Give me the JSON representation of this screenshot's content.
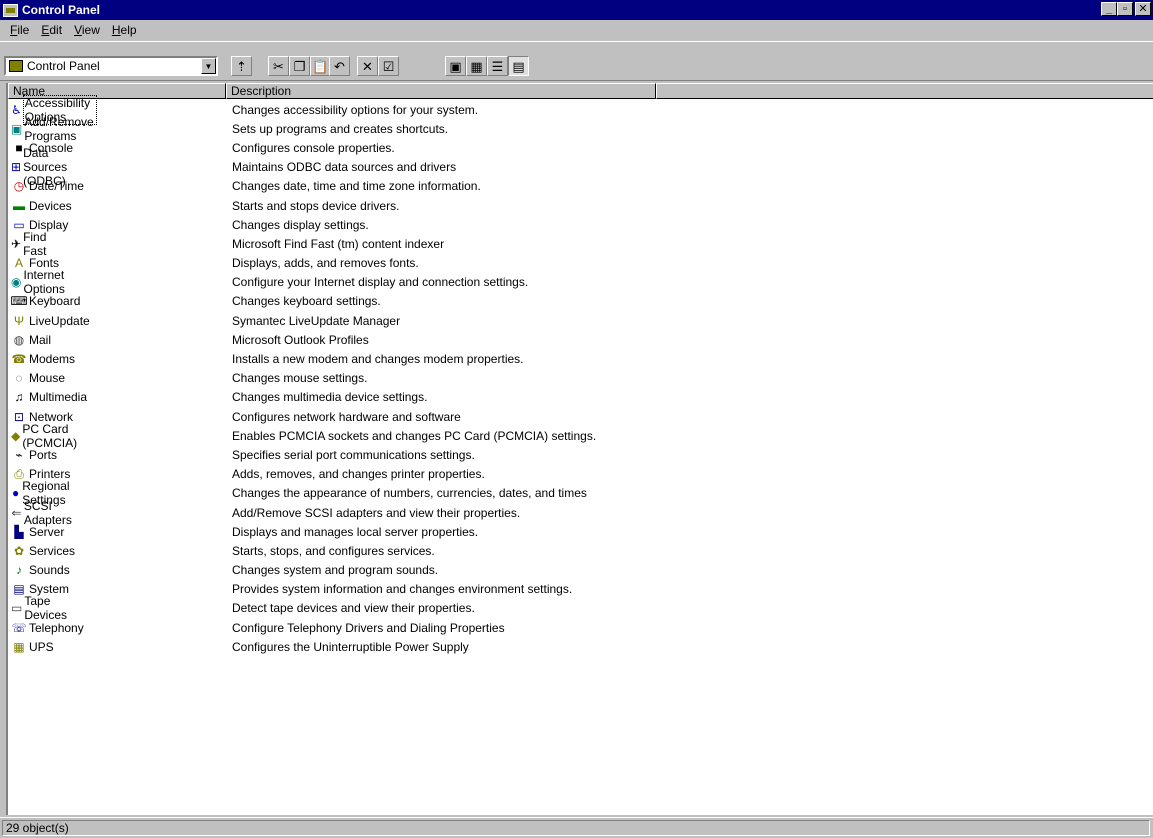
{
  "window": {
    "title": "Control Panel",
    "buttons": [
      "_",
      "▫",
      "✕"
    ]
  },
  "menu": [
    {
      "label": "File"
    },
    {
      "label": "Edit"
    },
    {
      "label": "View"
    },
    {
      "label": "Help"
    }
  ],
  "address": {
    "value": "Control Panel"
  },
  "toolbar": {
    "buttons": [
      {
        "icon": "up-folder-icon",
        "glyph": "⇡"
      },
      {
        "icon": "cut-icon",
        "glyph": "✂"
      },
      {
        "icon": "copy-icon",
        "glyph": "❐"
      },
      {
        "icon": "paste-icon",
        "glyph": "📋"
      },
      {
        "icon": "undo-icon",
        "glyph": "↶"
      },
      {
        "icon": "delete-icon",
        "glyph": "✕"
      },
      {
        "icon": "properties-icon",
        "glyph": "☑"
      },
      {
        "icon": "large-icons-view-icon",
        "glyph": "▣"
      },
      {
        "icon": "small-icons-view-icon",
        "glyph": "▦"
      },
      {
        "icon": "list-view-icon",
        "glyph": "☰"
      },
      {
        "icon": "details-view-icon",
        "glyph": "▤"
      }
    ]
  },
  "columns": {
    "name": "Name",
    "description": "Description"
  },
  "items": [
    {
      "name": "Accessibility Options",
      "description": "Changes accessibility options for your system.",
      "icon": "accessibility-icon",
      "glyph": "♿",
      "color": "#0000c0"
    },
    {
      "name": "Add/Remove Programs",
      "description": "Sets up programs and creates shortcuts.",
      "icon": "add-remove-programs-icon",
      "glyph": "▣",
      "color": "#008080"
    },
    {
      "name": "Console",
      "description": "Configures console properties.",
      "icon": "console-icon",
      "glyph": "■",
      "color": "#000000"
    },
    {
      "name": "Data Sources (ODBC)",
      "description": "Maintains ODBC data sources and drivers",
      "icon": "odbc-icon",
      "glyph": "⊞",
      "color": "#0000a0"
    },
    {
      "name": "Date/Time",
      "description": "Changes date, time and time zone information.",
      "icon": "date-time-icon",
      "glyph": "◷",
      "color": "#c00000"
    },
    {
      "name": "Devices",
      "description": "Starts and stops device drivers.",
      "icon": "devices-icon",
      "glyph": "▬",
      "color": "#008000"
    },
    {
      "name": "Display",
      "description": "Changes display settings.",
      "icon": "display-icon",
      "glyph": "▭",
      "color": "#0000c0"
    },
    {
      "name": "Find Fast",
      "description": "Microsoft Find Fast (tm) content indexer",
      "icon": "find-fast-icon",
      "glyph": "✈",
      "color": "#000000"
    },
    {
      "name": "Fonts",
      "description": "Displays, adds, and removes fonts.",
      "icon": "fonts-icon",
      "glyph": "A",
      "color": "#808000"
    },
    {
      "name": "Internet Options",
      "description": "Configure your Internet display and connection settings.",
      "icon": "internet-options-icon",
      "glyph": "◉",
      "color": "#008080"
    },
    {
      "name": "Keyboard",
      "description": "Changes keyboard settings.",
      "icon": "keyboard-icon",
      "glyph": "⌨",
      "color": "#000000"
    },
    {
      "name": "LiveUpdate",
      "description": "Symantec LiveUpdate Manager",
      "icon": "liveupdate-icon",
      "glyph": "Ψ",
      "color": "#808000"
    },
    {
      "name": "Mail",
      "description": "Microsoft Outlook Profiles",
      "icon": "mail-icon",
      "glyph": "◍",
      "color": "#404040"
    },
    {
      "name": "Modems",
      "description": "Installs a new modem and changes modem properties.",
      "icon": "modems-icon",
      "glyph": "☎",
      "color": "#808000"
    },
    {
      "name": "Mouse",
      "description": "Changes mouse settings.",
      "icon": "mouse-icon",
      "glyph": "◌",
      "color": "#404040"
    },
    {
      "name": "Multimedia",
      "description": "Changes multimedia device settings.",
      "icon": "multimedia-icon",
      "glyph": "♫",
      "color": "#000000"
    },
    {
      "name": "Network",
      "description": "Configures network hardware and software",
      "icon": "network-icon",
      "glyph": "⊡",
      "color": "#000080"
    },
    {
      "name": "PC Card (PCMCIA)",
      "description": "Enables PCMCIA sockets and changes PC Card (PCMCIA) settings.",
      "icon": "pc-card-icon",
      "glyph": "◆",
      "color": "#808000"
    },
    {
      "name": "Ports",
      "description": "Specifies serial port communications settings.",
      "icon": "ports-icon",
      "glyph": "⌁",
      "color": "#000000"
    },
    {
      "name": "Printers",
      "description": "Adds, removes, and changes printer properties.",
      "icon": "printers-icon",
      "glyph": "⎙",
      "color": "#808000"
    },
    {
      "name": "Regional Settings",
      "description": "Changes the appearance of numbers, currencies, dates, and times",
      "icon": "regional-settings-icon",
      "glyph": "●",
      "color": "#0000c0"
    },
    {
      "name": "SCSI Adapters",
      "description": "Add/Remove SCSI adapters and view their properties.",
      "icon": "scsi-adapters-icon",
      "glyph": "⇐",
      "color": "#404040"
    },
    {
      "name": "Server",
      "description": "Displays and manages local server properties.",
      "icon": "server-icon",
      "glyph": "▙",
      "color": "#000080"
    },
    {
      "name": "Services",
      "description": "Starts, stops, and configures services.",
      "icon": "services-icon",
      "glyph": "✿",
      "color": "#808000"
    },
    {
      "name": "Sounds",
      "description": "Changes system and program sounds.",
      "icon": "sounds-icon",
      "glyph": "♪",
      "color": "#008000"
    },
    {
      "name": "System",
      "description": "Provides system information and changes environment settings.",
      "icon": "system-icon",
      "glyph": "▤",
      "color": "#000080"
    },
    {
      "name": "Tape Devices",
      "description": "Detect tape devices and view their properties.",
      "icon": "tape-devices-icon",
      "glyph": "▭",
      "color": "#404040"
    },
    {
      "name": "Telephony",
      "description": "Configure Telephony Drivers and Dialing Properties",
      "icon": "telephony-icon",
      "glyph": "☏",
      "color": "#000080"
    },
    {
      "name": "UPS",
      "description": "Configures the Uninterruptible Power Supply",
      "icon": "ups-icon",
      "glyph": "▦",
      "color": "#808000"
    }
  ],
  "selected_index": 0,
  "status": {
    "text": "29 object(s)"
  }
}
